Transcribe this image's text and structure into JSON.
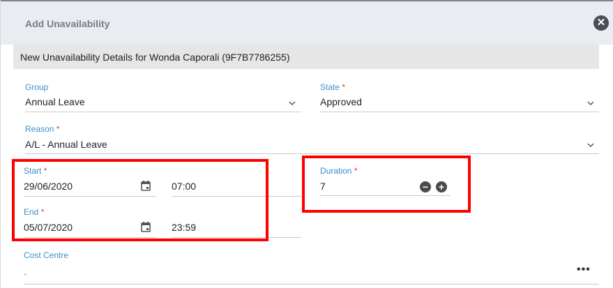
{
  "dialog": {
    "title": "Add Unavailability",
    "close_icon": "close-icon"
  },
  "section": {
    "header": "New Unavailability Details for Wonda Caporali (9F7B7786255)"
  },
  "group": {
    "label": "Group",
    "value": "Annual Leave"
  },
  "state": {
    "label": "State",
    "required": "*",
    "value": "Approved"
  },
  "reason": {
    "label": "Reason",
    "required": "*",
    "value": "A/L - Annual Leave"
  },
  "start": {
    "label": "Start",
    "required": "*",
    "date": "29/06/2020",
    "time": "07:00"
  },
  "end": {
    "label": "End",
    "required": "*",
    "date": "05/07/2020",
    "time": "23:59"
  },
  "duration": {
    "label": "Duration",
    "required": "*",
    "value": "7"
  },
  "cost_centre": {
    "label": "Cost Centre",
    "value": "-",
    "more": "•••"
  },
  "colors": {
    "accent_label": "#3a8fc7",
    "required": "#e53935",
    "highlight": "#ff0000"
  }
}
